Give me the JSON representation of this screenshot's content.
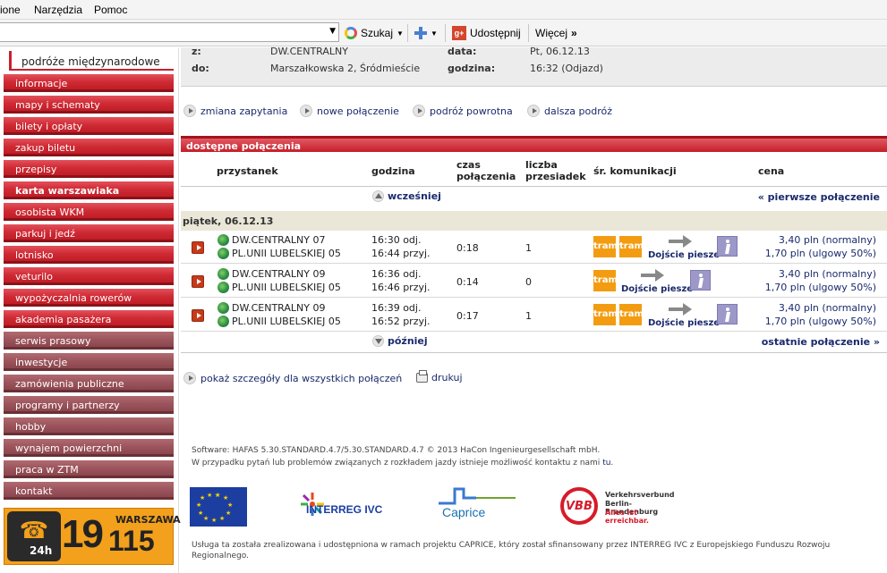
{
  "browser": {
    "menu": [
      "ione",
      "Narzędzia",
      "Pomoc"
    ],
    "toolbar": {
      "search_label": "Szukaj",
      "share_label": "Udostępnij",
      "more_label": "Więcej"
    }
  },
  "sidebar": {
    "first_item": "podróże międzynarodowe",
    "items": [
      {
        "label": "informacje"
      },
      {
        "label": "mapy i schematy"
      },
      {
        "label": "bilety i opłaty"
      },
      {
        "label": "zakup biletu"
      },
      {
        "label": "przepisy"
      },
      {
        "label": "karta warszawiaka"
      },
      {
        "label": "osobista WKM"
      },
      {
        "label": "parkuj i jedź"
      },
      {
        "label": "lotnisko"
      },
      {
        "label": "veturilo"
      },
      {
        "label": "wypożyczalnia rowerów"
      },
      {
        "label": "akademia pasażera"
      },
      {
        "label": "serwis prasowy"
      },
      {
        "label": "inwestycje"
      },
      {
        "label": "zamówienia publiczne"
      },
      {
        "label": "programy i partnerzy"
      },
      {
        "label": "hobby"
      },
      {
        "label": "wynajem powierzchni"
      },
      {
        "label": "praca w ZTM"
      },
      {
        "label": "kontakt"
      }
    ],
    "hotline": {
      "hours": "24h",
      "digits": "19",
      "city": "WARSZAWA",
      "number": "115"
    }
  },
  "query": {
    "from_label": "z:",
    "from_value": "DW.CENTRALNY",
    "to_label": "do:",
    "to_value": "Marszałkowska 2, Śródmieście",
    "date_label": "data:",
    "date_value": "Pt, 06.12.13",
    "time_label": "godzina:",
    "time_value": "16:32 (Odjazd)"
  },
  "actions": {
    "change": "zmiana zapytania",
    "new": "nowe połączenie",
    "return": "podróż powrotna",
    "further": "dalsza podróż"
  },
  "results": {
    "header": "dostępne połączenia",
    "columns": {
      "stop": "przystanek",
      "time": "godzina",
      "duration_1": "czas",
      "duration_2": "połączenia",
      "changes_1": "liczba",
      "changes_2": "przesiadek",
      "means": "śr. komunikacji",
      "price": "cena"
    },
    "earlier": "wcześniej",
    "first": "« pierwsze połączenie",
    "later": "później",
    "last": "ostatnie połączenie »",
    "date": "piątek, 06.12.13",
    "connections": [
      {
        "from": "DW.CENTRALNY 07",
        "to": "PL.UNII LUBELSKIEJ 05",
        "dep": "16:30 odj.",
        "arr": "16:44 przyj.",
        "duration": "0:18",
        "changes": "1",
        "modes": [
          "tram",
          "tram"
        ],
        "walk": "Dojście piesze",
        "price_normal": "3,40 pln (normalny)",
        "price_reduced": "1,70 pln (ulgowy 50%)"
      },
      {
        "from": "DW.CENTRALNY 09",
        "to": "PL.UNII LUBELSKIEJ 05",
        "dep": "16:36 odj.",
        "arr": "16:46 przyj.",
        "duration": "0:14",
        "changes": "0",
        "modes": [
          "tram"
        ],
        "walk": "Dojście piesze",
        "price_normal": "3,40 pln (normalny)",
        "price_reduced": "1,70 pln (ulgowy 50%)"
      },
      {
        "from": "DW.CENTRALNY 09",
        "to": "PL.UNII LUBELSKIEJ 05",
        "dep": "16:39 odj.",
        "arr": "16:52 przyj.",
        "duration": "0:17",
        "changes": "1",
        "modes": [
          "tram",
          "tram"
        ],
        "walk": "Dojście piesze",
        "price_normal": "3,40 pln (normalny)",
        "price_reduced": "1,70 pln (ulgowy 50%)"
      }
    ],
    "show_details": "pokaż szczegóły dla wszystkich połączeń",
    "print": "drukuj"
  },
  "footer": {
    "software": "Software: HAFAS 5.30.STANDARD.4.7/5.30.STANDARD.4.7 © 2013 HaCon Ingenieurgesellschaft mbH.",
    "contact": "W przypadku pytań lub problemów związanych z rozkładem jazdy istnieje możliwość kontaktu z nami",
    "contact_link": "tu",
    "logos": {
      "interreg": "INTERREG IVC",
      "caprice": "Caprice",
      "vbb": "VBB",
      "vbb_line1": "Verkehrsverbund",
      "vbb_line2": "Berlin-Brandenburg",
      "vbb_line3": "Alles ist erreichbar."
    },
    "funding": "Usługa ta została zrealizowana i udostępniona w ramach projektu CAPRICE, który został sfinansowany przez INTERREG IVC z Europejskiego Funduszu Rozwoju Regionalnego."
  }
}
